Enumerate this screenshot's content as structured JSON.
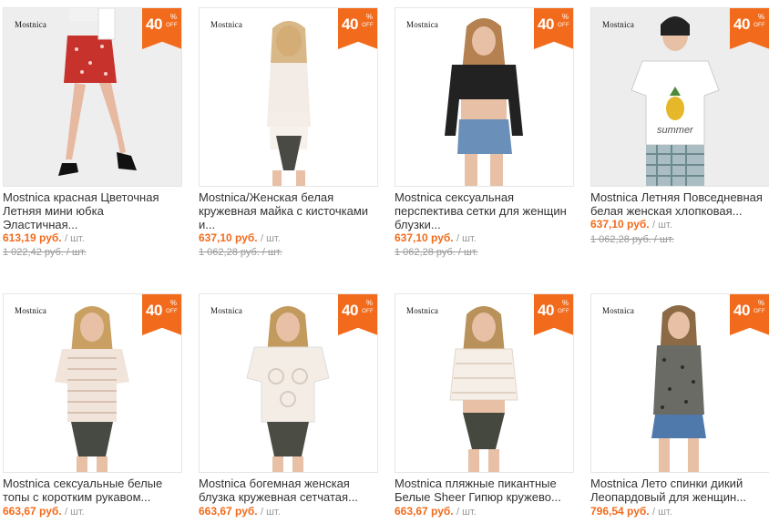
{
  "colors": {
    "accent": "#f26b1c",
    "muted": "#999999",
    "text": "#333333"
  },
  "products": [
    {
      "brand": "Mostnica",
      "discount": "40",
      "pct": "%",
      "off": "OFF",
      "title": "Mostnica красная Цветочная Летняя мини юбка Эластичная...",
      "price": "613,19 руб.",
      "unit": "/ шт.",
      "old_price": "1 022,42 руб. / шт."
    },
    {
      "brand": "Mostnica",
      "discount": "40",
      "pct": "%",
      "off": "OFF",
      "title": "Mostnica/Женская белая кружевная майка с кисточками и...",
      "price": "637,10 руб.",
      "unit": "/ шт.",
      "old_price": "1 062,28 руб. / шт."
    },
    {
      "brand": "Mostnica",
      "discount": "40",
      "pct": "%",
      "off": "OFF",
      "title": "Mostnica сексуальная перспектива сетки для женщин блузки...",
      "price": "637,10 руб.",
      "unit": "/ шт.",
      "old_price": "1 062,28 руб. / шт."
    },
    {
      "brand": "Mostnica",
      "discount": "40",
      "pct": "%",
      "off": "OFF",
      "title": "Mostnica Летняя Повседневная белая женская хлопковая...",
      "price": "637,10 руб.",
      "unit": "/ шт.",
      "old_price": "1 062,28 руб. / шт.",
      "print_text": "summer"
    },
    {
      "brand": "Mostnica",
      "discount": "40",
      "pct": "%",
      "off": "OFF",
      "title": "Mostnica сексуальные белые топы с коротким рукавом...",
      "price": "663,67 руб.",
      "unit": "/ шт.",
      "old_price": ""
    },
    {
      "brand": "Mostnica",
      "discount": "40",
      "pct": "%",
      "off": "OFF",
      "title": "Mostnica богемная женская блузка кружевная сетчатая...",
      "price": "663,67 руб.",
      "unit": "/ шт.",
      "old_price": ""
    },
    {
      "brand": "Mostnica",
      "discount": "40",
      "pct": "%",
      "off": "OFF",
      "title": "Mostnica пляжные пикантные Белые Sheer Гипюр кружево...",
      "price": "663,67 руб.",
      "unit": "/ шт.",
      "old_price": ""
    },
    {
      "brand": "Mostnica",
      "discount": "40",
      "pct": "%",
      "off": "OFF",
      "title": "Mostnica Лето спинки дикий Леопардовый для женщин...",
      "price": "796,54 руб.",
      "unit": "/ шт.",
      "old_price": ""
    }
  ]
}
